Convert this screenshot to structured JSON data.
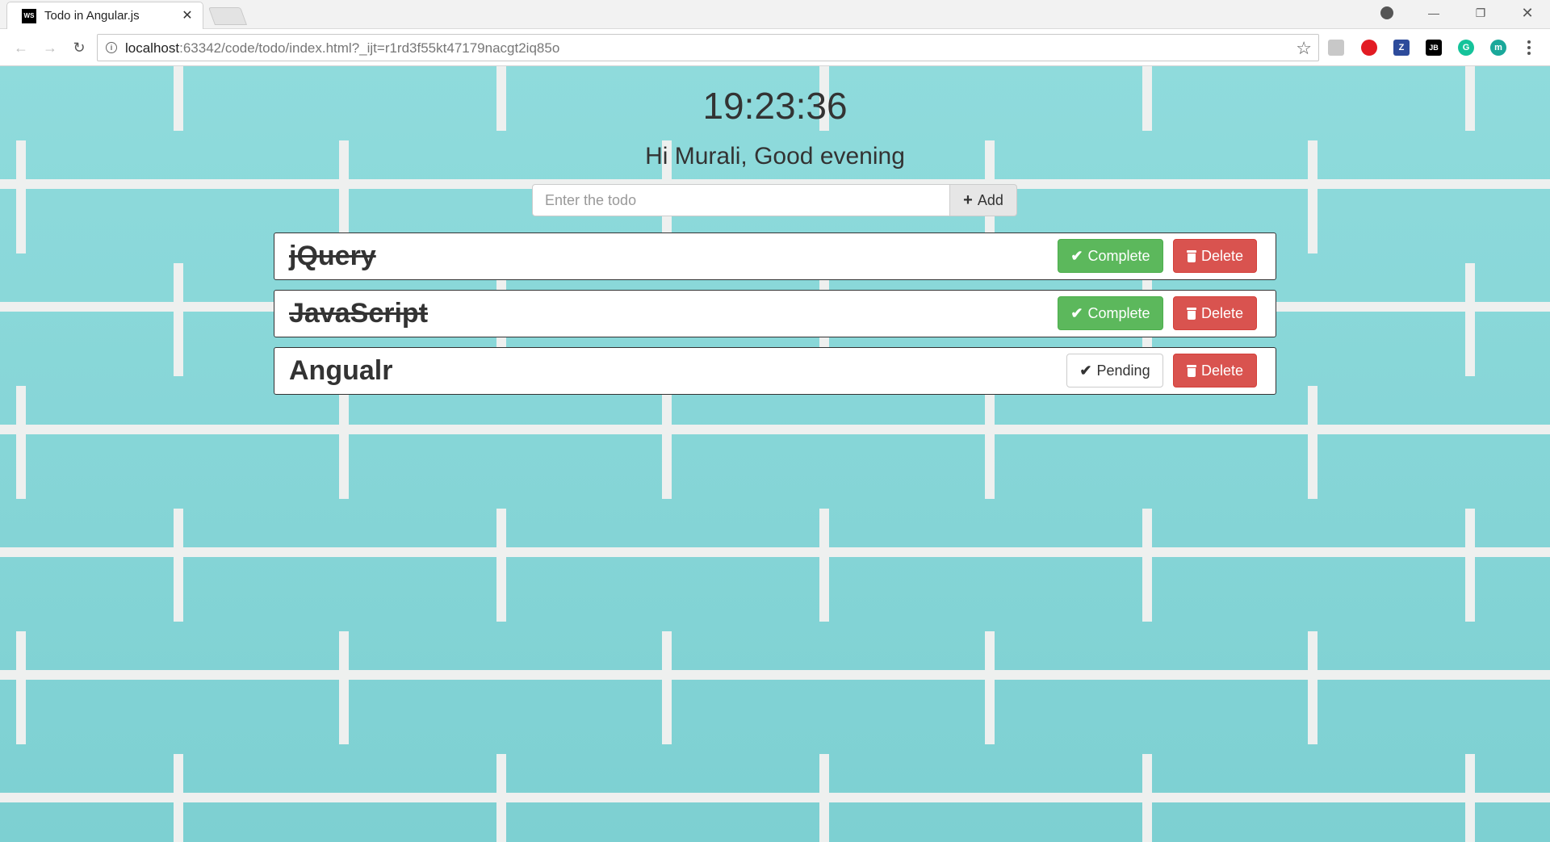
{
  "browser": {
    "tab_title": "Todo in Angular.js",
    "favicon_text": "WS",
    "url_host": "localhost",
    "url_rest": ":63342/code/todo/index.html?_ijt=r1rd3f55kt47179nacgt2iq85o",
    "extensions": [
      "acrobat-icon",
      "adblock-icon",
      "zotero-icon",
      "jetbrains-icon",
      "grammarly-icon",
      "meet-icon"
    ],
    "extension_labels": [
      "",
      "",
      "Z",
      "JB",
      "G",
      "m"
    ]
  },
  "page": {
    "clock": "19:23:36",
    "greeting": "Hi Murali, Good evening",
    "input_placeholder": "Enter the todo",
    "input_value": "",
    "add_label": "Add",
    "accent_colors": {
      "complete": "#5cb85c",
      "delete": "#d9534f",
      "background": "#86d7d8"
    }
  },
  "todos": [
    {
      "text": "jQuery",
      "status": "completed",
      "status_label": "Complete",
      "delete_label": "Delete"
    },
    {
      "text": "JavaScript",
      "status": "completed",
      "status_label": "Complete",
      "delete_label": "Delete"
    },
    {
      "text": "Angualr",
      "status": "pending",
      "status_label": "Pending",
      "delete_label": "Delete"
    }
  ]
}
